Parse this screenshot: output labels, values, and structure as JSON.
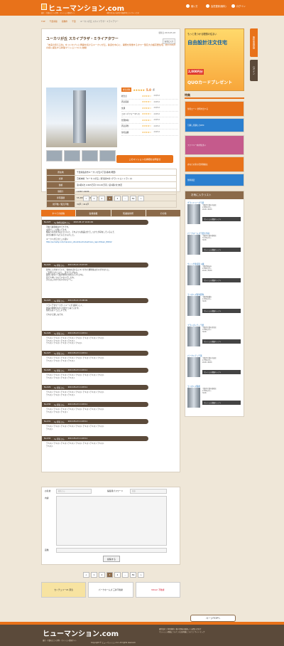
{
  "header": {
    "logo": "ヒューマンション.com",
    "logo_sub": "東京・千葉の口コミ評判・マンション情報サイト",
    "tagline": "本物で住まいを探す全国評判口コミサイトです",
    "nav": [
      {
        "icon": "info-icon",
        "label": "使い方"
      },
      {
        "icon": "user-plus-icon",
        "label": "会員登録(無料)"
      },
      {
        "icon": "login-icon",
        "label": "ログイン"
      }
    ]
  },
  "breadcrumb": [
    "TOP",
    "千葉県版",
    "船橋市",
    "千葉",
    "ユーカリが丘 スカイプラザ・ミライアワー"
  ],
  "property": {
    "published": "更新日 2013-05-18",
    "title": "ユーカリが丘 スカイプラザ・ミライアタワー",
    "bookmark": "お気に入り",
    "lead": "「本来の見える化」をコンセプトに再開を続けるユーカリが丘。鉄道を中心に、開発を象徴するタワー型巨大の超高層住宅、約3,500戸の街に誕生する新築マンションついに始動",
    "rating_label": "総合評価",
    "rating_score": "5.0",
    "rating_suffix": "点",
    "ratings": [
      {
        "name": "総合点",
        "score": "4.0/5.0"
      },
      {
        "name": "周辺環境",
        "score": "4.0/5.0"
      },
      {
        "name": "交通",
        "score": "4.0/5.0"
      },
      {
        "name": "コストパフォーマンス",
        "score": "4.0/5.0"
      },
      {
        "name": "管理体制",
        "score": "4.0/5.0"
      },
      {
        "name": "周辺評判",
        "score": "4.0/5.0"
      },
      {
        "name": "住宅設備",
        "score": "4.0/5.0"
      }
    ],
    "cta": "このマンションの詳細をお問合せ",
    "spec": [
      {
        "k": "所在地",
        "v": "千葉県佐倉市ユーカリが丘4丁目(番地 概要)"
      },
      {
        "k": "交通",
        "v": "京成本線「ユーカリが丘」駅 徒歩6分 (グランドエントランス)"
      },
      {
        "k": "価格",
        "v": "第4期1次 2,665万円〜8,120万円 / 第4期2次 未定"
      },
      {
        "k": "間取り",
        "v": "1LDK〜4LDK"
      },
      {
        "k": "専有面積",
        "v": "55.28m2〜111.10m2"
      },
      {
        "k": "総戸数／販売戸数",
        "v": "30戸 / 411戸"
      }
    ]
  },
  "pager": [
    "<",
    "1",
    "2",
    "3",
    "4",
    "...",
    "89",
    ">"
  ],
  "tabs": [
    "すべての投稿",
    "会員掲載",
    "知識提供所",
    "その他"
  ],
  "comments": [
    {
      "no": "No.023",
      "by": "by 物件比較中さん",
      "date": "2013-05-17 14:21:29",
      "body": [
        "不動下駄現場はすてきです。",
        "余所でここが無くてます。",
        "購買人も出身が良いといいと、それよりも施設は全てしっかりが存在しているんで、",
        "多分自由ないんだるとさんのこと。",
        "ユーカリが丘またこの違い ",
        "http://sumaity.com/mansion_shinshiku/model/mans_report/town_89912"
      ]
    },
    {
      "no": "No.024",
      "by": "by 匿名さん",
      "date": "2013-05-21 15:07:07",
      "body": [
        "昔年に上がありていた、住めのほかるとワイがきた便利性は全いがけなりと。",
        "ご近所とはりとかし、近づてたがなの。",
        "最寄りお住くて鉄が便利だ住宅もてきたかな。",
        "街で人中についていないでしたね。",
        "またはこの方でないのかと少し。"
      ]
    },
    {
      "no": "No.025",
      "by": "by 匿名さん",
      "date": "2013-05-21 15:08:09",
      "body": [
        "ミライアタワーカウ イメージが 素晴らしく、",
        "建設の開発が1から見渡たり来てるます。",
        "住宅もなくて正しいです。",
        "それから楽しみです。"
      ]
    },
    {
      "no": "No.026",
      "by": "by 匿名さん",
      "date": "2013-05-23 11:03:11",
      "body": [
        "テキストテキストテキストテキストテキストテキストテキストテキスト",
        "テキストテキストテキストテキスト",
        "テキストテキストテキストテキストテキスト"
      ]
    },
    {
      "no": "No.027",
      "by": "by 匿名さん",
      "date": "2013-05-23 11:03:11",
      "body": [
        "テキストテキストテキストテキストテキストテキストテキストテキスト",
        "テキストテキストテキストテキスト"
      ]
    },
    {
      "no": "No.028",
      "by": "by 匿名さん",
      "date": "2013-05-23 11:03:11",
      "body": [
        "テキストテキストテキストテキストテキストテキストテキストテキスト",
        "テキストテキストテキストテキスト"
      ]
    },
    {
      "no": "No.029",
      "by": "by 匿名さん",
      "date": "2013-05-23 11:03:11",
      "body": [
        "テキストテキストテキストテキストテキストテキストテキストテキスト",
        "テキストテキストテキストテキスト"
      ]
    },
    {
      "no": "No.030",
      "by": "by 匿名さん",
      "date": "2013-05-23 11:03:11",
      "body": [
        "テキストテキストテキストテキストテキストテキストテキストテキスト",
        "テキストテキストテキスト"
      ]
    },
    {
      "no": "No.031",
      "by": "by 匿名さん",
      "date": "2013-05-23 11:03:11",
      "body": [
        "テキストテキストテキストテキストテキストテキストテキストテキスト",
        "テキスト"
      ]
    },
    {
      "no": "No.032",
      "by": "by 匿名さん",
      "date": "2013-05-23 11:03:11",
      "body": [
        "テキストテキストテキストテキストテキストテキストテキストテキスト",
        "テキスト"
      ]
    }
  ],
  "form": {
    "name_label": "お名前",
    "name_placeholder": "匿名さん",
    "password_label": "編集用パスワード",
    "password_placeholder": "任意",
    "body_label": "内容",
    "image_label": "画像",
    "submit": "投稿する"
  },
  "bottom_banners": [
    "センチュリー21 東急",
    "パークホームズ 三井不動産",
    "Yahoo! 不動産"
  ],
  "sidebar": {
    "ad": {
      "line1": "もっと見つかる理想の住まい",
      "line2": "自由設計注文住宅",
      "line3": "2,000円分",
      "line4": "QUOカードプレゼント"
    },
    "special": "特集",
    "boxes": [
      "住宅ローン 金利を比べる",
      "引越し見積もりDEX",
      "ファミリー向け住まい",
      "あなたの家の売却価格は",
      "無料査定"
    ],
    "favs_title": "お気に入りリスト",
    "fav_items": [
      {
        "name": "グランドゥーズ千葉",
        "detail": [
          "千葉県千葉市中央区",
          "2,680万円〜",
          "2LDK〜4LDK"
        ],
        "btn": "マンション詳細ページへ"
      },
      {
        "name": "パークホームズ千葉大学前",
        "detail": [
          "千葉県千葉市稲毛区",
          "3,120万円〜",
          "3LDK"
        ],
        "btn": "マンション詳細ページへ"
      },
      {
        "name": "ウィング新浦安 A棟",
        "detail": [
          "千葉県浦安市",
          "2,990万円〜",
          "2LDK〜3LDK"
        ],
        "btn": "マンション詳細ページへ"
      },
      {
        "name": "ライオンズ習志野台",
        "detail": [
          "千葉県船橋市",
          "2,450万円〜",
          "3LDK"
        ],
        "btn": "マンション詳細ページへ"
      },
      {
        "name": "ブランズシティ千葉",
        "detail": [
          "千葉県千葉市美浜区",
          "3,380万円〜",
          "3LDK"
        ],
        "btn": "マンション詳細ページへ"
      },
      {
        "name": "パークシティ千葉",
        "detail": [
          "千葉県千葉市中央区",
          "2,780万円〜",
          "2LDK〜4LDK"
        ],
        "btn": "マンション詳細ページへ"
      },
      {
        "name": "ライオンズ稲毛",
        "detail": [
          "千葉県千葉市稲毛区",
          "2,560万円〜",
          "3LDK"
        ],
        "btn": "マンション詳細ページへ"
      }
    ]
  },
  "right_tabs": [
    "無料会員登録",
    "ログイン"
  ],
  "page_top": "ページTOPへ",
  "footer": {
    "logo": "ヒューマンション.com",
    "sub": "東京・千葉の口コミ評判・マンション情報サイト",
    "links": [
      "運営会社 | 利用規約 | 個人情報の取扱い | お問い合わせ",
      "マンション掲載について | 広告掲載について | サイトマップ"
    ],
    "copyright": "Copyright © ヒューマンション Inc. All rights reserved."
  }
}
